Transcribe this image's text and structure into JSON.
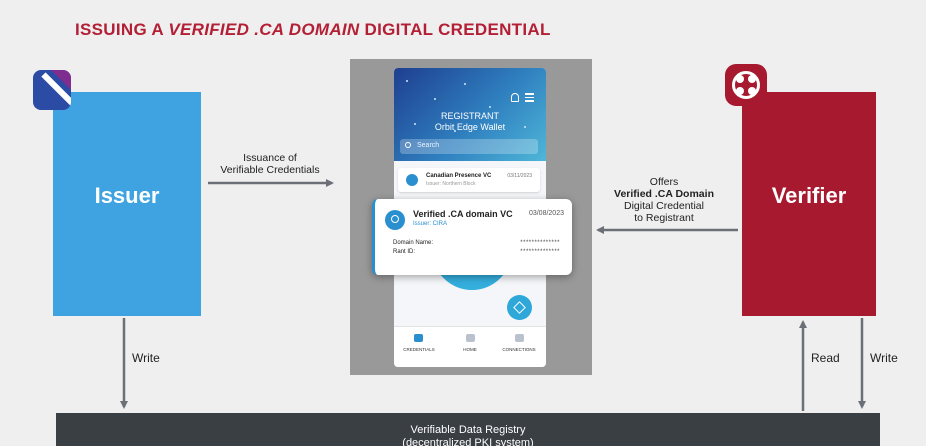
{
  "title": {
    "part1": "ISSUING A ",
    "italic": "VERIFIED .CA DOMAIN",
    "part2": " DIGITAL CREDENTIAL"
  },
  "issuer": {
    "label": "Issuer"
  },
  "verifier": {
    "label": "Verifier"
  },
  "arrows": {
    "issuance_line1": "Issuance of",
    "issuance_line2": "Verifiable Credentials",
    "offers_line1": "Offers",
    "offers_line2": "Verified .CA Domain",
    "offers_line3": "Digital Credential",
    "offers_line4": "to Registrant",
    "write_left": "Write",
    "read_right": "Read",
    "write_right": "Write"
  },
  "phone": {
    "header_line1": "REGISTRANT",
    "header_line2": "Orbit Edge Wallet",
    "search_placeholder": "Search",
    "small_card": {
      "name": "Canadian Presence VC",
      "issuer": "Issuer: Northern Block",
      "date": "03/11/2023"
    },
    "nav": [
      "CREDENTIALS",
      "HOME",
      "CONNECTIONS"
    ]
  },
  "credential_card": {
    "name": "Verified .CA domain VC",
    "date": "03/08/2023",
    "issuer": "Issuer: CIRA",
    "rows": [
      {
        "label": "Domain Name:",
        "value": "**************"
      },
      {
        "label": "Rant ID:",
        "value": "**************"
      }
    ]
  },
  "registry": {
    "line1": "Verifiable Data Registry",
    "line2": "(decentralized PKI system)"
  },
  "colors": {
    "title_red": "#b32035",
    "issuer_blue": "#3ea3e0",
    "verifier_red": "#a6192e",
    "registry_dark": "#3a3f44",
    "arrow_gray": "#6b7077"
  }
}
